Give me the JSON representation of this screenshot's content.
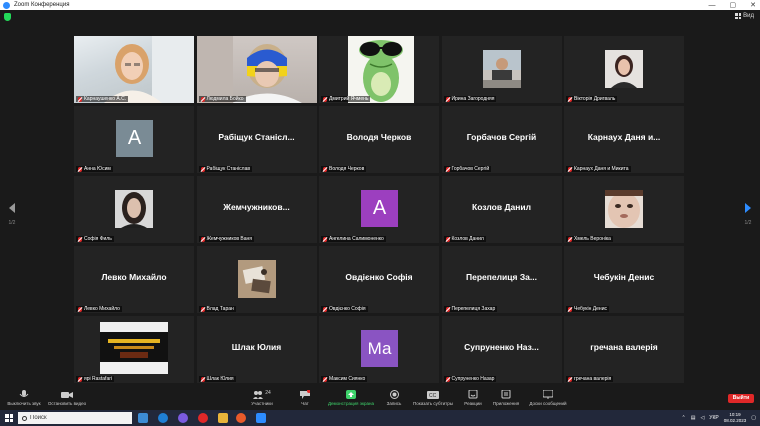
{
  "window": {
    "title": "Zoom Конференция"
  },
  "top": {
    "view_label": "Вид"
  },
  "pager": {
    "left_num": "1/2",
    "right_num": "1/2"
  },
  "participants": [
    {
      "tile": "video-girl",
      "caption": "Карнаушенко А.С."
    },
    {
      "tile": "video-woman",
      "caption": "Людмила Бойко"
    },
    {
      "tile": "video-frog",
      "caption": "Дмитрий Ячмень"
    },
    {
      "tile": "photo",
      "caption": "Ирина Загородняя"
    },
    {
      "tile": "photo",
      "caption": "Вікторія Дригваль"
    },
    {
      "tile": "letter",
      "letter": "А",
      "color": "#7a8b95",
      "caption": "Анна Юсим"
    },
    {
      "tile": "name",
      "name": "Рабіщук Станісл...",
      "caption": "Рабіщук Станіслав"
    },
    {
      "tile": "name",
      "name": "Володя Черков",
      "caption": "Володя Черков"
    },
    {
      "tile": "name",
      "name": "Горбачов Сергій",
      "caption": "Горбачов Сергій"
    },
    {
      "tile": "name",
      "name": "Карнаух Даня и...",
      "caption": "Карнаух Даня и Микита"
    },
    {
      "tile": "photo",
      "caption": "Софія Филь"
    },
    {
      "tile": "name",
      "name": "Жемчужников...",
      "caption": "Жемчужников Ваня"
    },
    {
      "tile": "letter",
      "letter": "А",
      "color": "#9c3fbf",
      "caption": "Ангелина Салимоненко"
    },
    {
      "tile": "name",
      "name": "Козлов Данил",
      "caption": "Козлов Данил"
    },
    {
      "tile": "photo",
      "caption": "Хмель Вероніка"
    },
    {
      "tile": "name",
      "name": "Левко Михайло",
      "caption": "Левко Михайло"
    },
    {
      "tile": "photo",
      "caption": "Влад Таран"
    },
    {
      "tile": "name",
      "name": "Овдієнко Софія",
      "caption": "Овдієнко Софія"
    },
    {
      "tile": "name",
      "name": "Перепелиця За...",
      "caption": "Перепелиця Захар"
    },
    {
      "tile": "name",
      "name": "Чебукін Денис",
      "caption": "Чебукін Денис"
    },
    {
      "tile": "photo",
      "caption": "ярі Rastafari"
    },
    {
      "tile": "name",
      "name": "Шлак Юлия",
      "caption": "Шлак Юлия"
    },
    {
      "tile": "letter",
      "letter": "Ма",
      "color": "#8a54c2",
      "caption": "Максим Сиянко"
    },
    {
      "tile": "name",
      "name": "Супруненко Наз...",
      "caption": "Супруненко Назар"
    },
    {
      "tile": "name",
      "name": "гречана валерія",
      "caption": "гречана валерія"
    }
  ],
  "toolbar": {
    "mute_label": "Выключить звук",
    "video_label": "Остановить видео",
    "participants_label": "Участники",
    "participants_count": "24",
    "chat_label": "Чат",
    "share_label": "Демонстрация экрана",
    "record_label": "Запись",
    "captions_label": "Показать субтитры",
    "reactions_label": "Реакции",
    "apps_label": "Приложения",
    "whiteboard_label": "Доски сообщений",
    "leave_label": "Выйти"
  },
  "taskbar": {
    "search_placeholder": "Поиск",
    "lang": "УКР",
    "time": "10:19",
    "date": "08.02.2023"
  },
  "colors": {
    "accent_blue": "#2d8cff",
    "active_border": "#b8d43a",
    "leave_red": "#e02828",
    "share_green": "#3ed36b"
  }
}
